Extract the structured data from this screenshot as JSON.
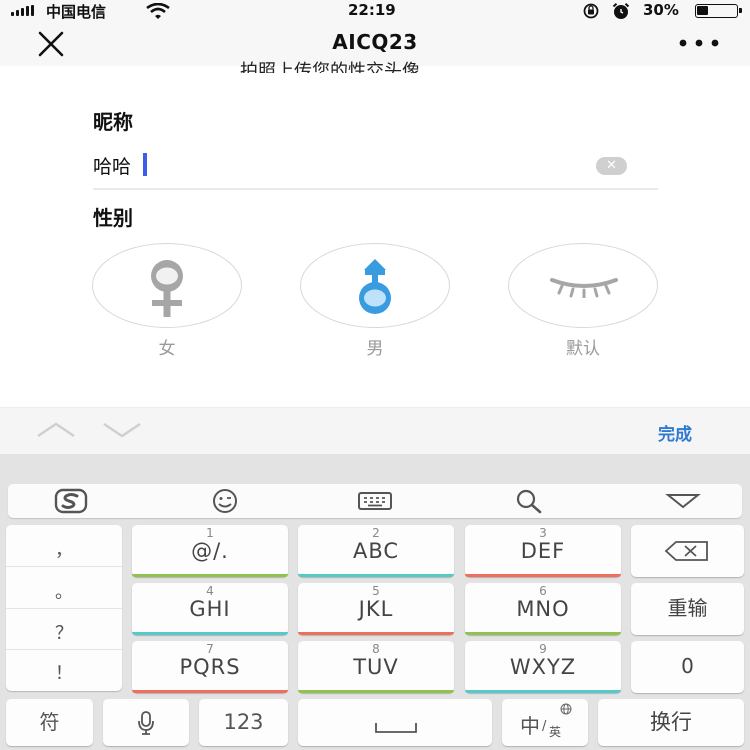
{
  "status_bar": {
    "carrier": "中国电信",
    "time": "22:19",
    "battery": "30%"
  },
  "nav": {
    "title": "AICQ23"
  },
  "form": {
    "clipped_text": "拍照上传您的性交头像",
    "nickname_label": "昵称",
    "nickname_value": "哈哈",
    "gender_label": "性别",
    "genders": [
      {
        "label": "女",
        "icon": "female-icon",
        "color": "#a6a6a6"
      },
      {
        "label": "男",
        "icon": "male-icon",
        "color": "#3a9ce0"
      },
      {
        "label": "默认",
        "icon": "closed-eye-icon",
        "color": "#a6a6a6"
      }
    ]
  },
  "toolbar": {
    "done": "完成"
  },
  "keyboard": {
    "side_keys": [
      "，",
      "。",
      "？",
      "！"
    ],
    "keys": [
      {
        "num": "1",
        "label": "@/.",
        "color": "#8fc24e"
      },
      {
        "num": "2",
        "label": "ABC",
        "color": "#56c9c9"
      },
      {
        "num": "3",
        "label": "DEF",
        "color": "#ef6e5e"
      },
      {
        "num": "4",
        "label": "GHI",
        "color": "#56c9c9"
      },
      {
        "num": "5",
        "label": "JKL",
        "color": "#ef6e5e"
      },
      {
        "num": "6",
        "label": "MNO",
        "color": "#8fc24e"
      },
      {
        "num": "7",
        "label": "PQRS",
        "color": "#ef6e5e"
      },
      {
        "num": "8",
        "label": "TUV",
        "color": "#8fc24e"
      },
      {
        "num": "9",
        "label": "WXYZ",
        "color": "#56c9c9"
      }
    ],
    "reinput": "重输",
    "zero": "0",
    "symbols": "符",
    "num123": "123",
    "lang_zh": "中",
    "lang_en": "英",
    "newline": "换行"
  }
}
